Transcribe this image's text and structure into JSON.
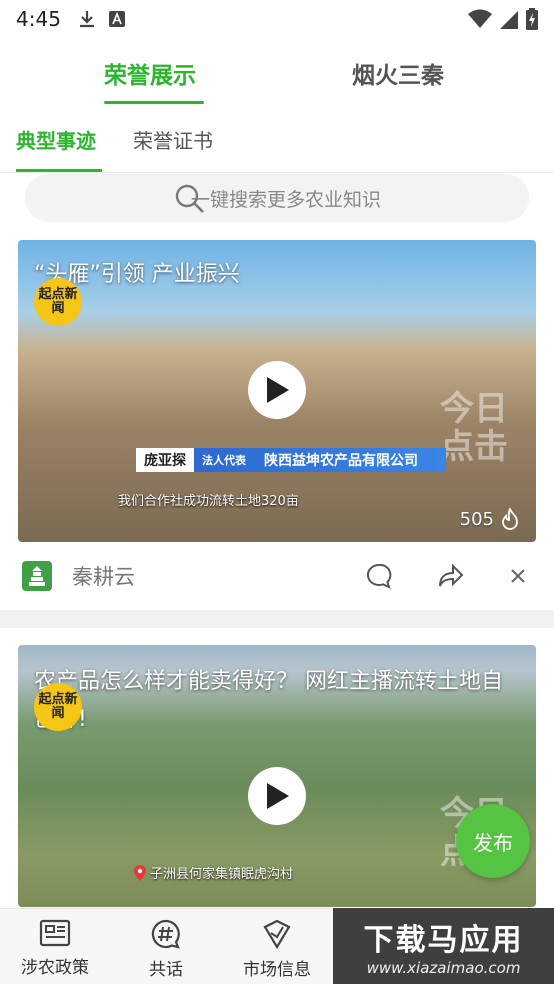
{
  "status": {
    "time": "4:45"
  },
  "top_tabs": [
    {
      "label": "荣誉展示",
      "active": true
    },
    {
      "label": "烟火三秦",
      "active": false
    }
  ],
  "sub_tabs": [
    {
      "label": "典型事迹",
      "active": true
    },
    {
      "label": "荣誉证书",
      "active": false
    }
  ],
  "search": {
    "placeholder": "一键搜索更多农业知识"
  },
  "feed": [
    {
      "title": "“头雁”引领 产业振兴",
      "badge": "起点新闻",
      "watermark": "今日点击",
      "caption_name": "庞亚探",
      "caption_role": "法人代表",
      "caption_company": "陕西益坤农产品有限公司",
      "subtitle": "我们合作社成功流转土地320亩",
      "likes": "505",
      "author": "秦耕云"
    },
    {
      "title": "农产品怎么样才能卖得好？ 网红主播流转土地自己种!",
      "badge": "起点新闻",
      "watermark": "今日点击",
      "location": "子洲县何家集镇眠虎沟村"
    }
  ],
  "publish_label": "发布",
  "bottom_nav": [
    {
      "label": "涉农政策",
      "icon": "policy-icon"
    },
    {
      "label": "共话",
      "icon": "hashtag-icon"
    },
    {
      "label": "市场信息",
      "icon": "market-icon"
    }
  ],
  "brand": {
    "main": "下载马应用",
    "url": "www.xiazaimao.com"
  },
  "colors": {
    "accent": "#2db52d",
    "publish": "#55c443"
  }
}
